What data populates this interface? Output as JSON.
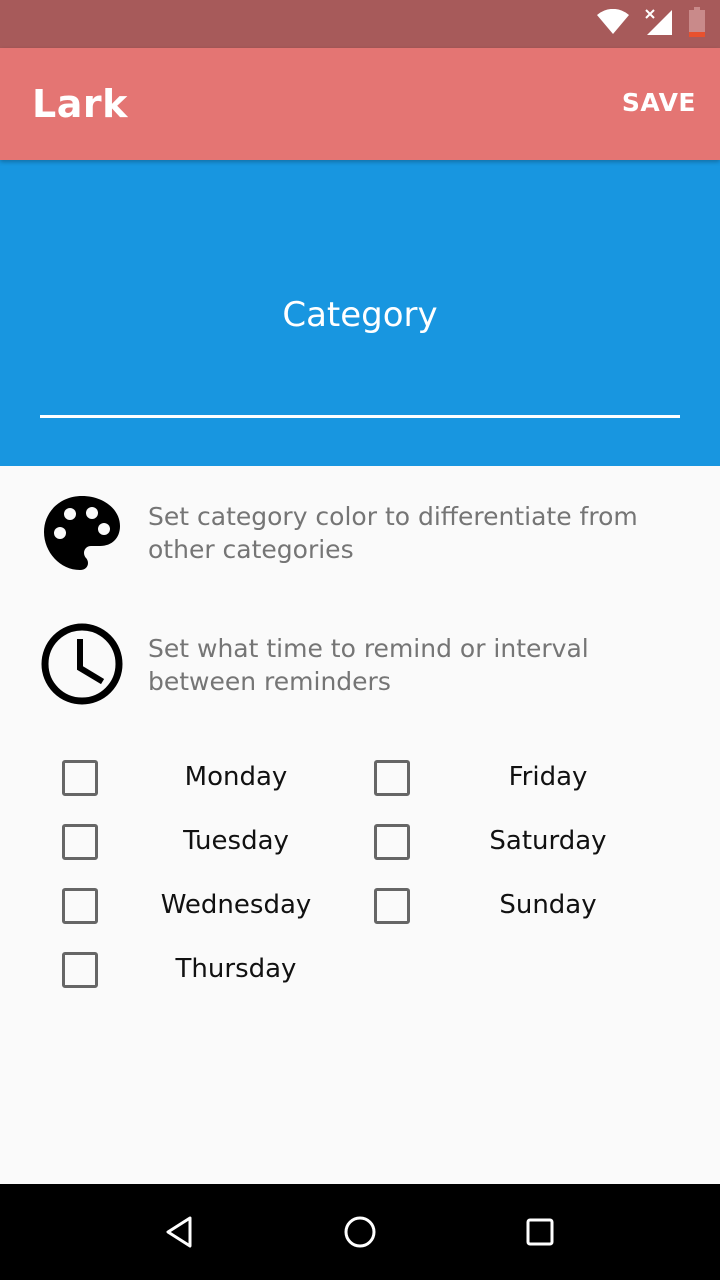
{
  "status_bar": {
    "icons": [
      "wifi-icon",
      "signal-icon",
      "battery-icon"
    ]
  },
  "app_bar": {
    "title": "Lark",
    "save_label": "SAVE"
  },
  "category": {
    "placeholder": "Category",
    "value": ""
  },
  "settings": {
    "color": {
      "text": "Set category color to differentiate from other categories",
      "icon": "palette-icon"
    },
    "reminder": {
      "text": "Set what time to remind or interval between reminders",
      "icon": "clock-icon"
    }
  },
  "days": [
    {
      "label": "Monday",
      "checked": false
    },
    {
      "label": "Tuesday",
      "checked": false
    },
    {
      "label": "Wednesday",
      "checked": false
    },
    {
      "label": "Thursday",
      "checked": false
    },
    {
      "label": "Friday",
      "checked": false
    },
    {
      "label": "Saturday",
      "checked": false
    },
    {
      "label": "Sunday",
      "checked": false
    }
  ],
  "nav_bar": {
    "icons": [
      "back-icon",
      "home-icon",
      "recents-icon"
    ]
  },
  "colors": {
    "status_bar": "#a75a5a",
    "app_bar": "#e47573",
    "category_header": "#1896e0",
    "background": "#fafafa"
  }
}
